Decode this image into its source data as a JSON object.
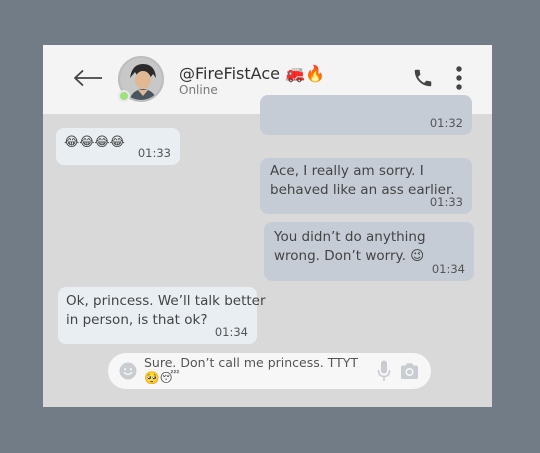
{
  "header": {
    "username": "@FireFistAce 🚒🔥",
    "status": "Online"
  },
  "messages": [
    {
      "direction": "out",
      "text_lines": [],
      "time": "01:32"
    },
    {
      "direction": "in",
      "text_lines": [
        "😂😂😂😂"
      ],
      "time": "01:33"
    },
    {
      "direction": "out",
      "text_lines": [
        "Ace, I really am sorry. I",
        "behaved like an ass earlier."
      ],
      "time": "01:33"
    },
    {
      "direction": "out",
      "text_lines": [
        "You didn’t do anything",
        "wrong. Don’t worry. 😉"
      ],
      "time": "01:34"
    },
    {
      "direction": "in",
      "text_lines": [
        "Ok, princess. We’ll talk better",
        "in person, is that ok?"
      ],
      "time": "01:34"
    }
  ],
  "composer": {
    "text_lines": [
      "Sure. Don’t call me princess. TTYT",
      "🥺😴"
    ]
  },
  "colors": {
    "background": "#727c86",
    "chat_background": "#d9d9d9",
    "header_background": "#f4f4f4",
    "incoming_bubble": "#e9eef2",
    "outgoing_bubble": "#c6ccd5",
    "online_dot": "#9fe07c"
  },
  "icons": [
    "back-arrow-icon",
    "phone-icon",
    "more-vertical-icon",
    "emoji-icon",
    "microphone-icon",
    "camera-icon"
  ]
}
